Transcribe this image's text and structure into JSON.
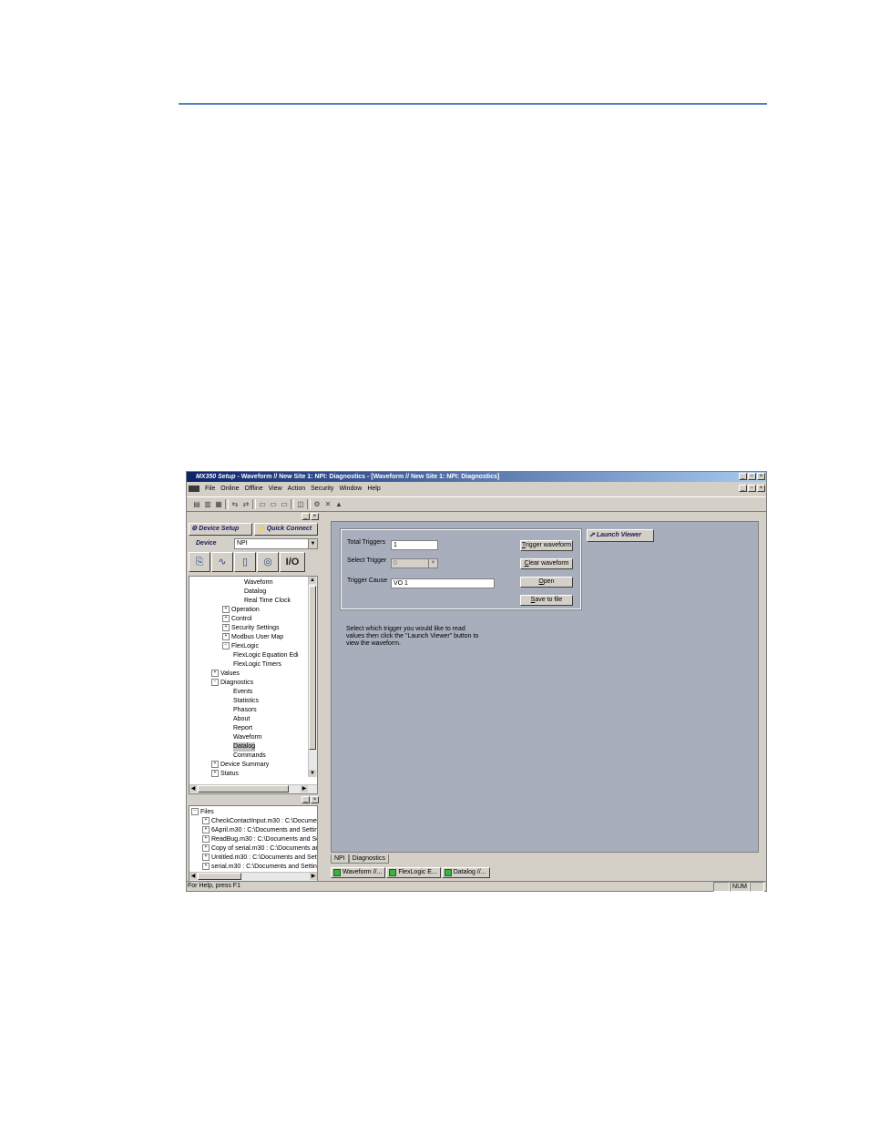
{
  "titlebar": {
    "app_name": "MX350 Setup",
    "title": " - Waveform // New Site 1: NPI: Diagnostics - [Waveform // New Site 1: NPI: Diagnostics]"
  },
  "window_controls": {
    "minimize": "_",
    "restore": "▫",
    "close": "×"
  },
  "menu": [
    "File",
    "Online",
    "Offline",
    "View",
    "Action",
    "Security",
    "Window",
    "Help"
  ],
  "nav": {
    "device_setup": "Device Setup",
    "quick_connect": "Quick Connect",
    "device_label": "Device",
    "device_value": "NPI",
    "io_label": "I/O"
  },
  "tree": {
    "items": [
      {
        "label": "Waveform",
        "expander": ""
      },
      {
        "label": "Datalog",
        "expander": ""
      },
      {
        "label": "Real Time Clock",
        "expander": ""
      },
      {
        "label": "Operation",
        "expander": "+"
      },
      {
        "label": "Control",
        "expander": "+"
      },
      {
        "label": "Security Settings",
        "expander": "+"
      },
      {
        "label": "Modbus User Map",
        "expander": "+"
      },
      {
        "label": "FlexLogic",
        "expander": "−"
      },
      {
        "label": "FlexLogic Equation Edi",
        "expander": ""
      },
      {
        "label": "FlexLogic Timers",
        "expander": ""
      },
      {
        "label": "Values",
        "expander": "+"
      },
      {
        "label": "Diagnostics",
        "expander": "−"
      },
      {
        "label": "Events",
        "expander": ""
      },
      {
        "label": "Statistics",
        "expander": ""
      },
      {
        "label": "Phasors",
        "expander": ""
      },
      {
        "label": "About",
        "expander": ""
      },
      {
        "label": "Report",
        "expander": ""
      },
      {
        "label": "Waveform",
        "expander": ""
      },
      {
        "label": "Datalog",
        "expander": ""
      },
      {
        "label": "Commands",
        "expander": ""
      },
      {
        "label": "Device Summary",
        "expander": "+"
      },
      {
        "label": "Status",
        "expander": "+"
      }
    ]
  },
  "files": {
    "root": "Files",
    "items": [
      "CheckContactInput.m30 : C:\\Documen",
      "6April.m30 : C:\\Documents and Setting",
      "ReadBug.m30 : C:\\Documents and Se",
      "Copy of serial.m30 : C:\\Documents and",
      "Untitled.m30 : C:\\Documents and Setti",
      "serial.m30 : C:\\Documents and Setting"
    ]
  },
  "form": {
    "total_triggers_label": "Total Triggers",
    "total_triggers_value": "1",
    "select_trigger_label": "Select Trigger",
    "select_trigger_value": "0",
    "trigger_cause_label": "Trigger Cause",
    "trigger_cause_value": "VO 1",
    "trigger_waveform_button": "Trigger waveform",
    "clear_waveform_button": "Clear waveform",
    "open_button": "Open",
    "save_to_file_button": "Save to file",
    "launch_viewer_button": "Launch Viewer",
    "help_text": "Select which trigger you would like to read values then click the \"Launch Viewer\" button to view the waveform."
  },
  "sheet_tabs": [
    "NPI",
    "Diagnostics"
  ],
  "window_tabs": [
    "Waveform //...",
    "FlexLogic E...",
    "Datalog //..."
  ],
  "status": {
    "help": "For Help, press F1",
    "num": "NUM"
  },
  "colors": {
    "accent_rule": "#4f81bd",
    "titlebar": "#0a246a",
    "client_bg": "#a9aebd"
  }
}
